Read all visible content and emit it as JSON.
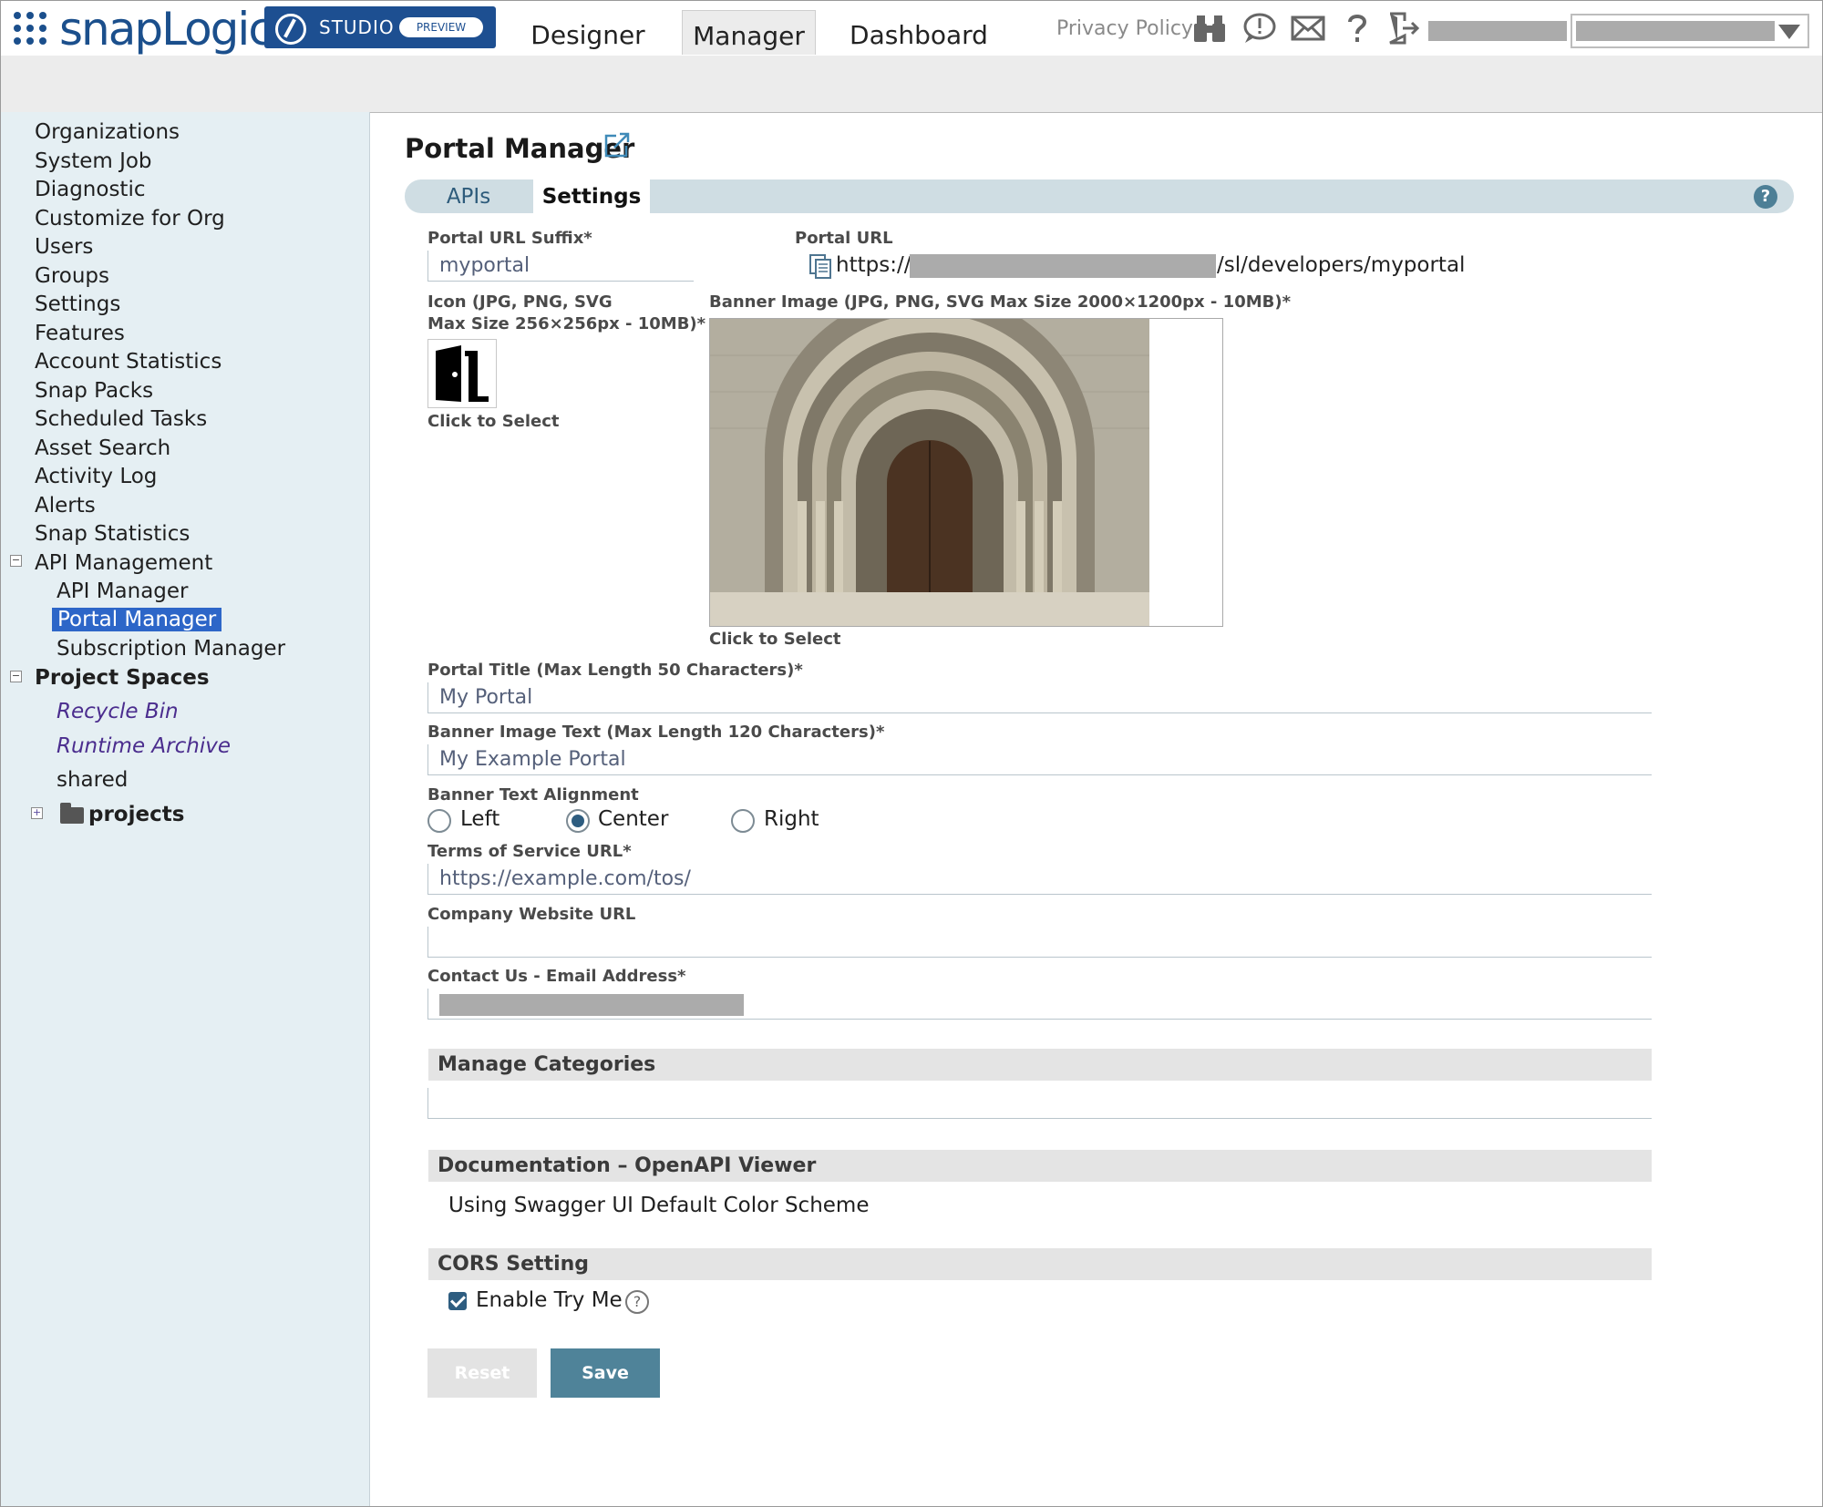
{
  "header": {
    "logo_text": "snapLogic",
    "studio_label": "STUDIO",
    "preview_badge": "PREVIEW",
    "nav": [
      "Designer",
      "Manager",
      "Dashboard"
    ],
    "active_nav": "Manager",
    "privacy_policy": "Privacy Policy",
    "icons": [
      "binoculars-icon",
      "alert-bubble-icon",
      "envelope-icon",
      "question-icon",
      "logout-icon"
    ]
  },
  "sidebar": {
    "items": [
      "Organizations",
      "System Job",
      "Diagnostic",
      "Customize for Org",
      "Users",
      "Groups",
      "Settings",
      "Features",
      "Account Statistics",
      "Snap Packs",
      "Scheduled Tasks",
      "Asset Search",
      "Activity Log",
      "Alerts",
      "Snap Statistics"
    ],
    "api_management": {
      "label": "API Management",
      "children": [
        "API Manager",
        "Portal Manager",
        "Subscription Manager"
      ],
      "selected": "Portal Manager"
    },
    "project_spaces": {
      "label": "Project Spaces",
      "recycle_bin": "Recycle Bin",
      "runtime_archive": "Runtime Archive",
      "shared": "shared",
      "projects": "projects"
    }
  },
  "main": {
    "title": "Portal Manager",
    "tabs": [
      "APIs",
      "Settings"
    ],
    "active_tab": "Settings",
    "help": "?",
    "portal_url_suffix_label": "Portal URL Suffix*",
    "portal_url_suffix_value": "myportal",
    "portal_url_label": "Portal URL",
    "portal_url_prefix": "https://",
    "portal_url_suffix_path": "/sl/developers/myportal",
    "icon_label_line1": "Icon (JPG, PNG, SVG",
    "icon_label_line2": "Max Size 256×256px - 10MB)*",
    "icon_click": "Click to Select",
    "banner_label": "Banner Image (JPG, PNG, SVG Max Size 2000×1200px - 10MB)*",
    "banner_click": "Click to Select",
    "portal_title_label": "Portal Title (Max Length 50 Characters)*",
    "portal_title_value": "My Portal",
    "banner_text_label": "Banner Image Text (Max Length 120 Characters)*",
    "banner_text_value": "My Example Portal",
    "alignment_label": "Banner Text Alignment",
    "alignment_options": [
      "Left",
      "Center",
      "Right"
    ],
    "alignment_selected": "Center",
    "tos_label": "Terms of Service URL*",
    "tos_value": "https://example.com/tos/",
    "company_label": "Company Website URL",
    "company_value": "",
    "contact_label": "Contact Us - Email Address*",
    "manage_categories": "Manage Categories",
    "documentation_head": "Documentation – OpenAPI Viewer",
    "documentation_text": "Using Swagger UI Default Color Scheme",
    "cors_head": "CORS Setting",
    "enable_try_me": "Enable Try Me",
    "enable_try_me_checked": true,
    "reset": "Reset",
    "save": "Save"
  },
  "colors": {
    "brand": "#1b4f8c",
    "sidebar_bg": "#e5eff3",
    "selected": "#2d66c8",
    "save_button": "#4f8399"
  }
}
